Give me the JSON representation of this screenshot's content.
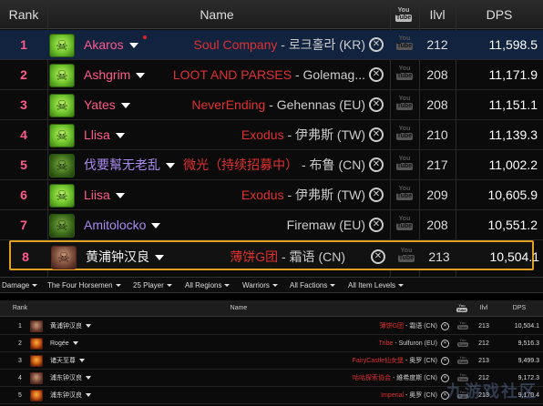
{
  "top_table": {
    "headers": {
      "rank": "Rank",
      "name": "Name",
      "video_top": "You",
      "video_bottom": "Tube",
      "ilvl": "Ilvl",
      "dps": "DPS"
    },
    "rows": [
      {
        "rank": "1",
        "name": "Akaros",
        "name_color": "#ff5a8a",
        "guild": "Soul Company",
        "server": " - 로크홀라 (KR)",
        "ilvl": "212",
        "dps": "11,598.5",
        "avatar": "green"
      },
      {
        "rank": "2",
        "name": "Ashgrim",
        "name_color": "#ff5a8a",
        "guild": "LOOT AND PARSES",
        "server": " - Golemag...",
        "ilvl": "208",
        "dps": "11,171.9",
        "avatar": "green"
      },
      {
        "rank": "3",
        "name": "Yates",
        "name_color": "#ff5a8a",
        "guild": "NeverEnding",
        "server": " - Gehennas (EU)",
        "ilvl": "208",
        "dps": "11,151.1",
        "avatar": "green"
      },
      {
        "rank": "4",
        "name": "Llisa",
        "name_color": "#ff5a8a",
        "guild": "Exodus",
        "server": " - 伊弗斯 (TW)",
        "ilvl": "210",
        "dps": "11,139.3",
        "avatar": "green"
      },
      {
        "rank": "5",
        "name": "伐要幫无老乱",
        "name_color": "#a88bf0",
        "guild": "微光（持续招募中）",
        "server": " - 布鲁 (CN)",
        "ilvl": "217",
        "dps": "11,002.2",
        "avatar": "dark"
      },
      {
        "rank": "6",
        "name": "Liisa",
        "name_color": "#ff5a8a",
        "guild": "Exodus",
        "server": " - 伊弗斯 (TW)",
        "ilvl": "209",
        "dps": "10,605.9",
        "avatar": "green"
      },
      {
        "rank": "7",
        "name": "Amitolocko",
        "name_color": "#a88bf0",
        "guild": "",
        "server": "Firemaw (EU)",
        "ilvl": "208",
        "dps": "10,551.2",
        "avatar": "dark"
      },
      {
        "rank": "8",
        "name": "黄浦钟汉良",
        "name_color": "#f0f0f0",
        "guild": "薄饼G团",
        "server": " - 霜语 (CN)",
        "ilvl": "213",
        "dps": "10,504.1",
        "avatar": "human"
      }
    ]
  },
  "filters": [
    "Damage",
    "The Four Horsemen",
    "25 Player",
    "All Regions",
    "Warriors",
    "All Factions",
    "All Item Levels"
  ],
  "bottom_table": {
    "headers": {
      "rank": "Rank",
      "name": "Name",
      "ilvl": "Ilvl",
      "dps": "DPS"
    },
    "rows": [
      {
        "rank": "1",
        "name": "黄浦钟汉良",
        "guild": "薄饼G团",
        "server": " - 霜语 (CN)",
        "ilvl": "213",
        "dps": "10,504.1",
        "avatar": "human"
      },
      {
        "rank": "2",
        "name": "Rogée",
        "guild": "Tribe",
        "server": " - Sulfuron (EU)",
        "ilvl": "212",
        "dps": "9,516.3",
        "avatar": "fire"
      },
      {
        "rank": "3",
        "name": "诸天至尊",
        "guild": "FairyCastle仙女堡",
        "server": " - 奥罗 (CN)",
        "ilvl": "213",
        "dps": "9,499.3",
        "avatar": "fire"
      },
      {
        "rank": "4",
        "name": "浦东钟汉良",
        "guild": "咕咕探索协会",
        "server": " - 維希度斯 (CN)",
        "ilvl": "212",
        "dps": "9,172.3",
        "avatar": "human"
      },
      {
        "rank": "5",
        "name": "浦东钟汉良",
        "guild": "Imperial",
        "server": " - 奥罗 (CN)",
        "ilvl": "213",
        "dps": "9,170.4",
        "avatar": "fire"
      }
    ]
  },
  "watermark": "九游戏社区",
  "colors": {
    "highlight_border": "#e0a020",
    "first_row_bg": "#11233f",
    "guild_red": "#e03030"
  }
}
